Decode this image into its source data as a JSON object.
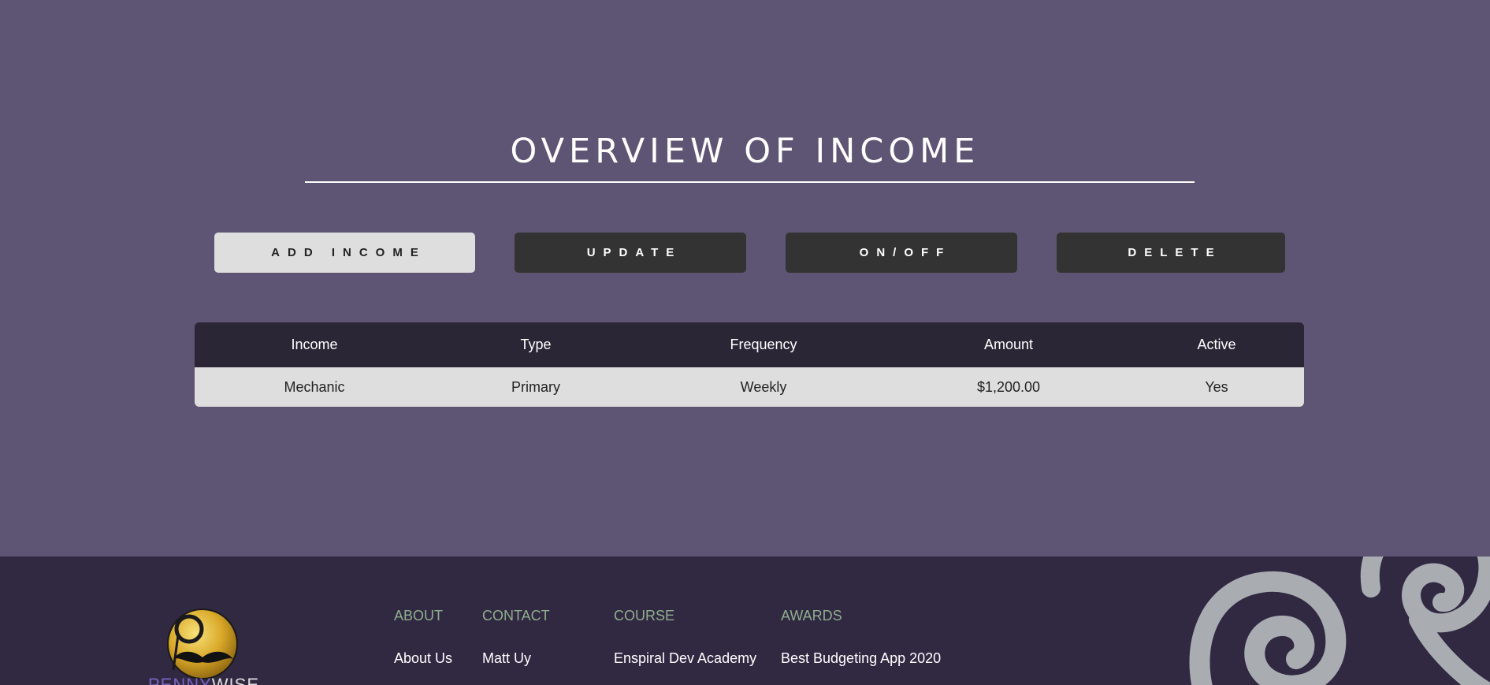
{
  "main": {
    "title": "OVERVIEW OF INCOME",
    "buttons": {
      "add": "ADD INCOME",
      "update": "UPDATE",
      "onoff": "ON/OFF",
      "delete": "DELETE"
    },
    "table": {
      "headers": [
        "Income",
        "Type",
        "Frequency",
        "Amount",
        "Active"
      ],
      "rows": [
        [
          "Mechanic",
          "Primary",
          "Weekly",
          "$1,200.00",
          "Yes"
        ]
      ]
    }
  },
  "footer": {
    "brand_part1": "PENNY",
    "brand_part2": "WISE",
    "columns": [
      {
        "heading": "ABOUT",
        "links": [
          "About Us"
        ]
      },
      {
        "heading": "CONTACT",
        "links": [
          "Matt Uy"
        ]
      },
      {
        "heading": "COURSE",
        "links": [
          "Enspiral Dev Academy"
        ]
      },
      {
        "heading": "AWARDS",
        "links": [
          "Best Budgeting App 2020"
        ]
      }
    ]
  },
  "colors": {
    "background": "#5e5473",
    "footer": "#312842",
    "table_header": "#2b2636",
    "button_dark": "#333333",
    "button_light": "#dedede",
    "footer_heading": "#8fae8d",
    "brand_accent": "#7a63c4"
  },
  "icons": [
    "pennywise-monocle-mustache-logo",
    "spiral-decoration"
  ]
}
